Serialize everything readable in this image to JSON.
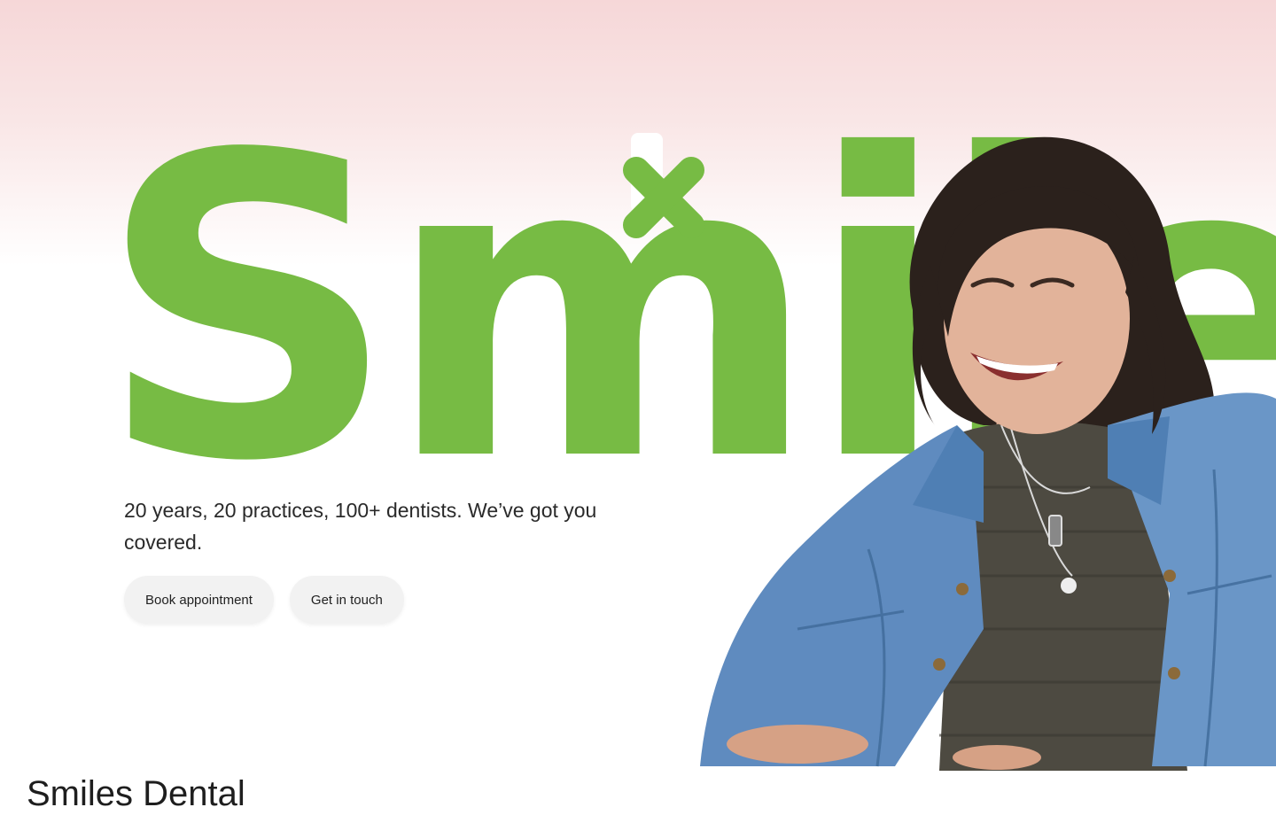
{
  "hero": {
    "wordmark": "Smile",
    "brand_color": "#77bb44",
    "background_gradient": [
      "#f6d7d8",
      "#ffffff"
    ],
    "tagline": "20 years, 20 practices, 100+ dentists. We’ve got you covered.",
    "buttons": {
      "book_label": "Book appointment",
      "contact_label": "Get in touch"
    }
  },
  "next_section": {
    "title": "Smiles Dental"
  }
}
